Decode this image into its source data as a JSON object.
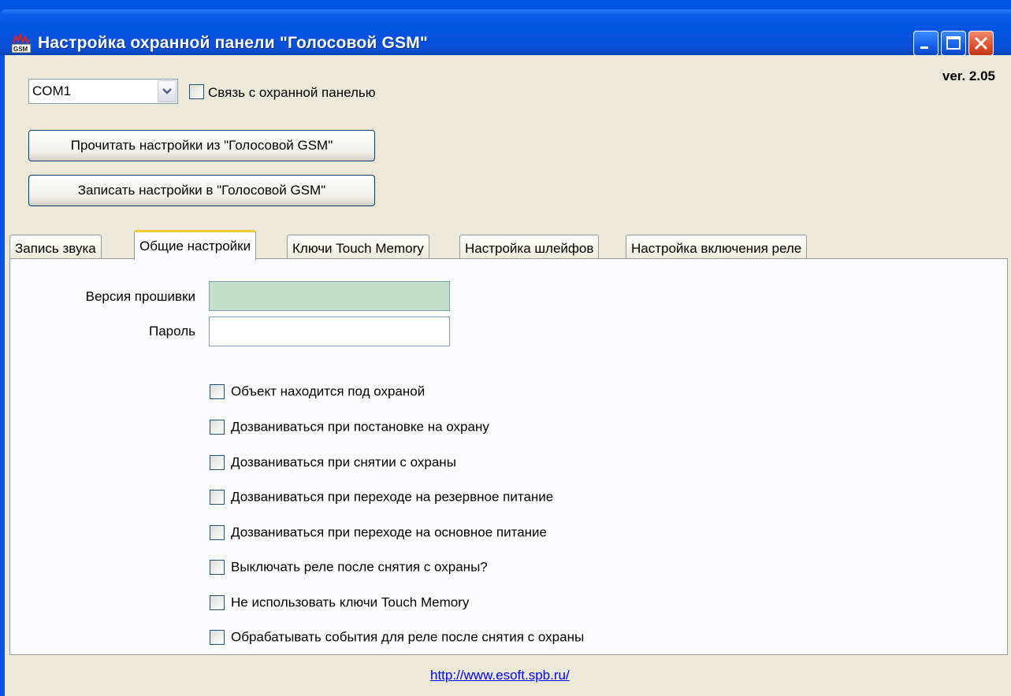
{
  "window": {
    "title": "Настройка охранной панели \"Голосовой GSM\"",
    "app_icon": "gsm-icon"
  },
  "header": {
    "version": "ver. 2.05",
    "port": {
      "selected": "COM1"
    },
    "connection_checkbox": {
      "label": "Связь с охранной панелью",
      "checked": false
    }
  },
  "actions": {
    "read_label": "Прочитать настройки из \"Голосовой GSM\"",
    "write_label": "Записать настройки в \"Голосовой GSM\""
  },
  "tabs": [
    {
      "label": "Запись звука",
      "active": false
    },
    {
      "label": "Общие настройки",
      "active": true
    },
    {
      "label": "Ключи Touch Memory",
      "active": false
    },
    {
      "label": "Настройка шлейфов",
      "active": false
    },
    {
      "label": "Настройка включения реле",
      "active": false
    }
  ],
  "general": {
    "firmware_label": "Версия прошивки",
    "firmware_value": "",
    "password_label": "Пароль",
    "password_value": "",
    "options": [
      {
        "label": "Объект находится под охраной",
        "checked": false
      },
      {
        "label": "Дозваниваться при постановке на охрану",
        "checked": false
      },
      {
        "label": "Дозваниваться при снятии с охраны",
        "checked": false
      },
      {
        "label": "Дозваниваться при переходе на резервное  питание",
        "checked": false
      },
      {
        "label": "Дозваниваться при переходе на основное питание",
        "checked": false
      },
      {
        "label": "Выключать реле после снятия с охраны?",
        "checked": false
      },
      {
        "label": "Не использовать ключи Touch Memory",
        "checked": false
      },
      {
        "label": "Обрабатывать события для реле после снятия с охраны",
        "checked": false
      }
    ]
  },
  "footer": {
    "link": "http://www.esoft.spb.ru/"
  },
  "colors": {
    "titlebar": "#0054e3",
    "client": "#ece9d8",
    "firmware_field": "#c4dfc8",
    "tab_highlight": "#ffc83c"
  }
}
